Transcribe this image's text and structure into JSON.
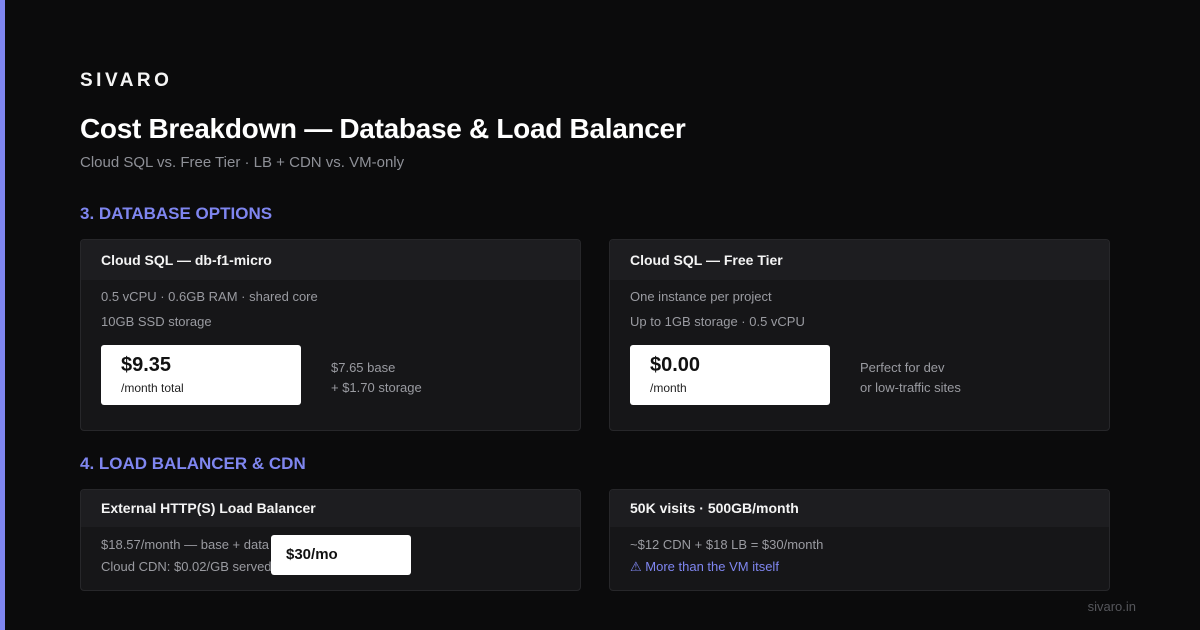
{
  "brand": "SIVARO",
  "title": "Cost Breakdown — Database & Load Balancer",
  "subtitle": "Cloud SQL vs. Free Tier · LB + CDN vs. VM-only",
  "section3": {
    "title": "3. DATABASE OPTIONS",
    "cards": [
      {
        "header": "Cloud SQL — db-f1-micro",
        "lines": [
          "0.5 vCPU · 0.6GB RAM · shared core",
          "10GB SSD storage"
        ],
        "price": "$9.35",
        "period": "/month total",
        "notes": [
          "$7.65 base",
          "+ $1.70 storage"
        ]
      },
      {
        "header": "Cloud SQL — Free Tier",
        "lines": [
          "One instance per project",
          "Up to 1GB storage · 0.5 vCPU"
        ],
        "price": "$0.00",
        "period": "/month",
        "notes": [
          "Perfect for dev",
          "or low-traffic sites"
        ]
      }
    ]
  },
  "section4": {
    "title": "4. LOAD BALANCER & CDN",
    "cards": [
      {
        "header": "External HTTP(S) Load Balancer",
        "lines": [
          "$18.57/month — base + data",
          "Cloud CDN: $0.02/GB served"
        ],
        "price": "$30/mo"
      },
      {
        "header": "50K visits · 500GB/month",
        "lines": [
          "~$12 CDN + $18 LB = $30/month"
        ],
        "warning": "⚠ More than the VM itself"
      }
    ]
  },
  "footer": "sivaro.in",
  "colors": {
    "background": "#0b0b0c",
    "accent": "#7f86f0",
    "card": "#161618",
    "card_header": "#1d1d20",
    "muted_text": "#9a9ba1",
    "price_box": "#ffffff"
  },
  "icons": {
    "warning": "warning-icon"
  }
}
